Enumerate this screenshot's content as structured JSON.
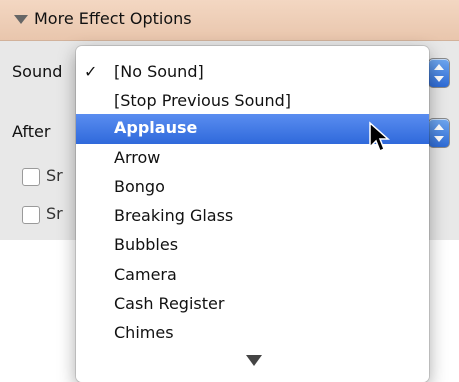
{
  "panel": {
    "title": "More Effect Options",
    "sound_label": "Sound",
    "after_label": "After",
    "checkbox1_label": "Sr",
    "checkbox2_label": "Sr"
  },
  "menu": {
    "checked_mark": "✓",
    "items": [
      "[No Sound]",
      "[Stop Previous Sound]",
      "Applause",
      "Arrow",
      "Bongo",
      "Breaking Glass",
      "Bubbles",
      "Camera",
      "Cash Register",
      "Chimes"
    ],
    "checked_index": 0,
    "highlighted_index": 2
  },
  "colors": {
    "highlight": "#3a74e0",
    "header": "#efd0b8"
  },
  "icons": [
    "disclosure-triangle-icon",
    "stepper-icon",
    "checkmark-icon",
    "scroll-down-arrow-icon",
    "mouse-pointer-icon"
  ]
}
